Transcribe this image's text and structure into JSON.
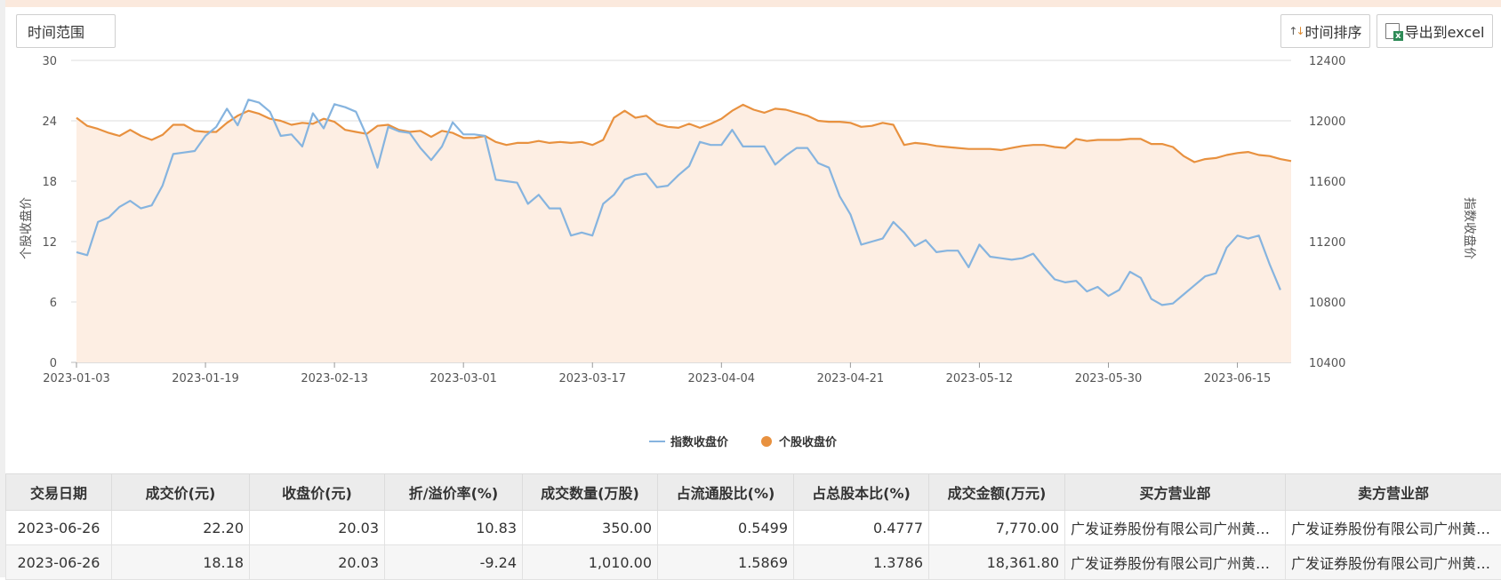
{
  "toolbar": {
    "time_range_label": "时间范围",
    "sort_label": "时间排序",
    "export_label": "导出到excel",
    "sort_icon": "sort-arrows-icon",
    "export_icon": "excel-export-icon"
  },
  "colors": {
    "index_line": "#86b4df",
    "stock_line": "#e8913f",
    "stock_fill": "#fdeee3",
    "grid": "#dddddd"
  },
  "chart_data": {
    "type": "line",
    "x": [
      "2023-01-03",
      "2023-01-04",
      "2023-01-05",
      "2023-01-06",
      "2023-01-09",
      "2023-01-10",
      "2023-01-11",
      "2023-01-12",
      "2023-01-13",
      "2023-01-16",
      "2023-01-17",
      "2023-01-18",
      "2023-01-19",
      "2023-01-20",
      "2023-01-30",
      "2023-01-31",
      "2023-02-01",
      "2023-02-02",
      "2023-02-03",
      "2023-02-06",
      "2023-02-07",
      "2023-02-08",
      "2023-02-09",
      "2023-02-10",
      "2023-02-13",
      "2023-02-14",
      "2023-02-15",
      "2023-02-16",
      "2023-02-17",
      "2023-02-20",
      "2023-02-21",
      "2023-02-22",
      "2023-02-23",
      "2023-02-24",
      "2023-02-27",
      "2023-02-28",
      "2023-03-01",
      "2023-03-02",
      "2023-03-03",
      "2023-03-06",
      "2023-03-07",
      "2023-03-08",
      "2023-03-09",
      "2023-03-10",
      "2023-03-13",
      "2023-03-14",
      "2023-03-15",
      "2023-03-16",
      "2023-03-17",
      "2023-03-20",
      "2023-03-21",
      "2023-03-22",
      "2023-03-23",
      "2023-03-24",
      "2023-03-27",
      "2023-03-28",
      "2023-03-29",
      "2023-03-30",
      "2023-03-31",
      "2023-04-03",
      "2023-04-04",
      "2023-04-06",
      "2023-04-07",
      "2023-04-10",
      "2023-04-11",
      "2023-04-12",
      "2023-04-13",
      "2023-04-14",
      "2023-04-17",
      "2023-04-18",
      "2023-04-19",
      "2023-04-20",
      "2023-04-21",
      "2023-04-24",
      "2023-04-25",
      "2023-04-26",
      "2023-04-27",
      "2023-04-28",
      "2023-05-04",
      "2023-05-05",
      "2023-05-08",
      "2023-05-09",
      "2023-05-10",
      "2023-05-11",
      "2023-05-12",
      "2023-05-15",
      "2023-05-16",
      "2023-05-17",
      "2023-05-18",
      "2023-05-19",
      "2023-05-22",
      "2023-05-23",
      "2023-05-24",
      "2023-05-25",
      "2023-05-26",
      "2023-05-29",
      "2023-05-30",
      "2023-05-31",
      "2023-06-01",
      "2023-06-02",
      "2023-06-05",
      "2023-06-06",
      "2023-06-07",
      "2023-06-08",
      "2023-06-09",
      "2023-06-12",
      "2023-06-13",
      "2023-06-14",
      "2023-06-15",
      "2023-06-16",
      "2023-06-19",
      "2023-06-20",
      "2023-06-21",
      "2023-06-26"
    ],
    "x_tick_labels": [
      "2023-01-03",
      "2023-01-19",
      "2023-02-13",
      "2023-03-01",
      "2023-03-17",
      "2023-04-04",
      "2023-04-21",
      "2023-05-12",
      "2023-05-30",
      "2023-06-15"
    ],
    "series": [
      {
        "name": "指数收盘价",
        "axis": "right",
        "values": [
          11130,
          11110,
          11330,
          11360,
          11430,
          11470,
          11420,
          11440,
          11570,
          11780,
          11790,
          11800,
          11900,
          11960,
          12080,
          11970,
          12140,
          12120,
          12060,
          11900,
          11910,
          11830,
          12050,
          11950,
          12110,
          12090,
          12060,
          11900,
          11690,
          11960,
          11930,
          11920,
          11820,
          11740,
          11830,
          11990,
          11910,
          11910,
          11900,
          11610,
          11600,
          11590,
          11450,
          11510,
          11420,
          11420,
          11240,
          11260,
          11240,
          11450,
          11510,
          11610,
          11640,
          11650,
          11560,
          11570,
          11640,
          11700,
          11860,
          11840,
          11840,
          11940,
          11830,
          11830,
          11830,
          11710,
          11770,
          11820,
          11820,
          11720,
          11690,
          11500,
          11380,
          11180,
          11200,
          11220,
          11330,
          11260,
          11170,
          11210,
          11130,
          11140,
          11140,
          11030,
          11180,
          11100,
          11090,
          11080,
          11090,
          11120,
          11030,
          10950,
          10930,
          10940,
          10870,
          10900,
          10840,
          10880,
          11000,
          10960,
          10820,
          10780,
          10790,
          10850,
          10910,
          10970,
          10990,
          11160,
          11240,
          11220,
          11240,
          11050,
          10880
        ]
      },
      {
        "name": "个股收盘价",
        "axis": "left",
        "values": [
          24.3,
          23.5,
          23.2,
          22.8,
          22.5,
          23.1,
          22.5,
          22.1,
          22.6,
          23.6,
          23.6,
          23.0,
          22.9,
          22.9,
          23.8,
          24.5,
          25.0,
          24.7,
          24.2,
          24.0,
          23.6,
          23.8,
          23.7,
          24.2,
          23.9,
          23.1,
          22.9,
          22.7,
          23.5,
          23.6,
          23.1,
          22.9,
          23.0,
          22.4,
          23.0,
          22.8,
          22.3,
          22.3,
          22.5,
          21.9,
          21.6,
          21.8,
          21.8,
          22.0,
          21.8,
          21.9,
          21.8,
          21.9,
          21.6,
          22.1,
          24.3,
          25.0,
          24.3,
          24.5,
          23.7,
          23.4,
          23.3,
          23.7,
          23.3,
          23.7,
          24.2,
          25.0,
          25.6,
          25.1,
          24.8,
          25.2,
          25.1,
          24.8,
          24.5,
          24.0,
          23.9,
          23.9,
          23.8,
          23.4,
          23.5,
          23.8,
          23.6,
          21.6,
          21.8,
          21.7,
          21.5,
          21.4,
          21.3,
          21.2,
          21.2,
          21.2,
          21.1,
          21.3,
          21.5,
          21.6,
          21.6,
          21.4,
          21.3,
          22.2,
          22.0,
          22.1,
          22.1,
          22.1,
          22.2,
          22.2,
          21.7,
          21.7,
          21.4,
          20.5,
          19.9,
          20.2,
          20.3,
          20.6,
          20.8,
          20.9,
          20.6,
          20.5,
          20.2,
          20.0
        ]
      }
    ],
    "left_axis": {
      "label": "个股收盘价",
      "range": [
        0,
        30
      ],
      "ticks": [
        "0",
        "6",
        "12",
        "18",
        "24",
        "30"
      ]
    },
    "right_axis": {
      "label": "指数收盘价",
      "range": [
        10400,
        12400
      ],
      "ticks": [
        "10400",
        "10800",
        "11200",
        "11600",
        "12000",
        "12400"
      ]
    },
    "grid": true,
    "legend_position": "bottom-center"
  },
  "table": {
    "headers": [
      "交易日期",
      "成交价(元)",
      "收盘价(元)",
      "折/溢价率(%)",
      "成交数量(万股)",
      "占流通股比(%)",
      "占总股本比(%)",
      "成交金额(万元)",
      "买方营业部",
      "卖方营业部"
    ],
    "rows": [
      [
        "2023-06-26",
        "22.20",
        "20.03",
        "10.83",
        "350.00",
        "0.5499",
        "0.4777",
        "7,770.00",
        "广发证券股份有限公司广州黄埔大道证券营业部",
        "广发证券股份有限公司广州黄埔大道证券营业部"
      ],
      [
        "2023-06-26",
        "18.18",
        "20.03",
        "-9.24",
        "1,010.00",
        "1.5869",
        "1.3786",
        "18,361.80",
        "广发证券股份有限公司广州黄埔大道证券营业部",
        "广发证券股份有限公司广州黄埔大道证券营业部"
      ]
    ]
  }
}
